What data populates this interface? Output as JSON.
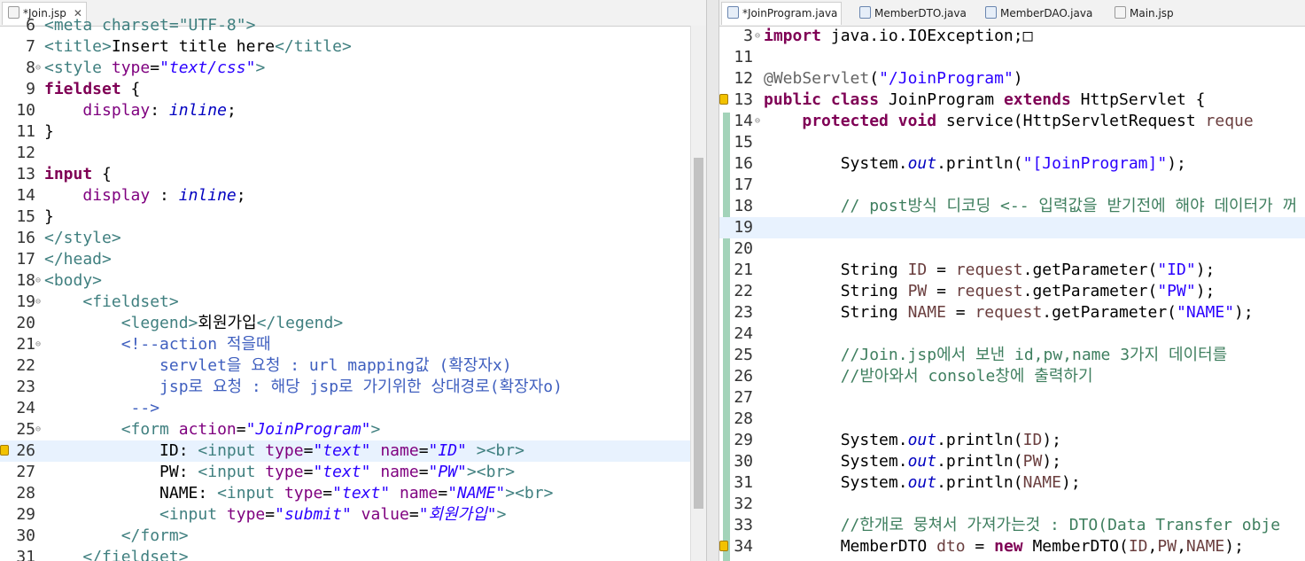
{
  "left_tabs": [
    {
      "label": "*Join.jsp",
      "icon": "jsp-file-icon"
    }
  ],
  "right_tabs": [
    {
      "label": "*JoinProgram.java",
      "icon": "java-file-icon"
    },
    {
      "label": "MemberDTO.java",
      "icon": "java-file-icon"
    },
    {
      "label": "MemberDAO.java",
      "icon": "java-file-icon"
    },
    {
      "label": "Main.jsp",
      "icon": "jsp-file-icon"
    }
  ],
  "left_lines": [
    {
      "n": "6",
      "t": [
        [
          "tag",
          "<meta charset=\"UTF-8\">"
        ]
      ]
    },
    {
      "n": "7",
      "t": [
        [
          "tag",
          "<title>"
        ],
        [
          "",
          "Insert title here"
        ],
        [
          "tag",
          "</title>"
        ]
      ]
    },
    {
      "n": "8",
      "fold": true,
      "t": [
        [
          "tag",
          "<style "
        ],
        [
          "attr",
          "type"
        ],
        [
          "",
          "="
        ],
        [
          "str",
          "\"text/css\""
        ],
        [
          "tag",
          ">"
        ]
      ]
    },
    {
      "n": "9",
      "t": [
        [
          "kw",
          "fieldset"
        ],
        [
          "",
          " {"
        ]
      ]
    },
    {
      "n": "10",
      "t": [
        [
          "",
          "    "
        ],
        [
          "attr",
          "display"
        ],
        [
          "",
          ": "
        ],
        [
          "fld",
          "inline"
        ],
        [
          "",
          ";"
        ]
      ]
    },
    {
      "n": "11",
      "t": [
        [
          "",
          "}"
        ]
      ]
    },
    {
      "n": "12",
      "t": []
    },
    {
      "n": "13",
      "t": [
        [
          "kw",
          "input"
        ],
        [
          "",
          " {"
        ]
      ]
    },
    {
      "n": "14",
      "t": [
        [
          "",
          "    "
        ],
        [
          "attr",
          "display"
        ],
        [
          "",
          " : "
        ],
        [
          "fld",
          "inline"
        ],
        [
          "",
          ";"
        ]
      ]
    },
    {
      "n": "15",
      "t": [
        [
          "",
          "}"
        ]
      ]
    },
    {
      "n": "16",
      "t": [
        [
          "tag",
          "</style>"
        ]
      ]
    },
    {
      "n": "17",
      "t": [
        [
          "tag",
          "</head>"
        ]
      ]
    },
    {
      "n": "18",
      "fold": true,
      "t": [
        [
          "tag",
          "<body>"
        ]
      ]
    },
    {
      "n": "19",
      "fold": true,
      "t": [
        [
          "",
          "    "
        ],
        [
          "tag",
          "<fieldset>"
        ]
      ]
    },
    {
      "n": "20",
      "t": [
        [
          "",
          "        "
        ],
        [
          "tag",
          "<legend>"
        ],
        [
          "",
          "회원가입"
        ],
        [
          "tag",
          "</legend>"
        ]
      ]
    },
    {
      "n": "21",
      "fold": true,
      "t": [
        [
          "",
          "        "
        ],
        [
          "cmt",
          "<!--action 적을때"
        ]
      ]
    },
    {
      "n": "22",
      "t": [
        [
          "",
          "            "
        ],
        [
          "cmt",
          "servlet을 요청 : url mapping값 (확장자x)"
        ]
      ]
    },
    {
      "n": "23",
      "t": [
        [
          "",
          "            "
        ],
        [
          "cmt",
          "jsp로 요청 : 해당 jsp로 가기위한 상대경로(확장자o)"
        ]
      ]
    },
    {
      "n": "24",
      "t": [
        [
          "",
          "         "
        ],
        [
          "cmt",
          "-->"
        ]
      ]
    },
    {
      "n": "25",
      "fold": true,
      "t": [
        [
          "",
          "        "
        ],
        [
          "tag",
          "<form "
        ],
        [
          "attr",
          "action"
        ],
        [
          "",
          "="
        ],
        [
          "str",
          "\"JoinProgram\""
        ],
        [
          "tag",
          ">"
        ]
      ]
    },
    {
      "n": "26",
      "hl": true,
      "mark": true,
      "t": [
        [
          "",
          "            ID: "
        ],
        [
          "tag",
          "<input "
        ],
        [
          "attr",
          "type"
        ],
        [
          "",
          "="
        ],
        [
          "str",
          "\"text\""
        ],
        [
          "",
          " "
        ],
        [
          "attr",
          "name"
        ],
        [
          "",
          "="
        ],
        [
          "str",
          "\"ID\""
        ],
        [
          "",
          " "
        ],
        [
          "tag",
          "><br>"
        ]
      ]
    },
    {
      "n": "27",
      "t": [
        [
          "",
          "            PW: "
        ],
        [
          "tag",
          "<input "
        ],
        [
          "attr",
          "type"
        ],
        [
          "",
          "="
        ],
        [
          "str",
          "\"text\""
        ],
        [
          "",
          " "
        ],
        [
          "attr",
          "name"
        ],
        [
          "",
          "="
        ],
        [
          "str",
          "\"PW\""
        ],
        [
          "tag",
          "><br>"
        ]
      ]
    },
    {
      "n": "28",
      "t": [
        [
          "",
          "            NAME: "
        ],
        [
          "tag",
          "<input "
        ],
        [
          "attr",
          "type"
        ],
        [
          "",
          "="
        ],
        [
          "str",
          "\"text\""
        ],
        [
          "",
          " "
        ],
        [
          "attr",
          "name"
        ],
        [
          "",
          "="
        ],
        [
          "str",
          "\"NAME\""
        ],
        [
          "tag",
          "><br>"
        ]
      ]
    },
    {
      "n": "29",
      "t": [
        [
          "",
          "            "
        ],
        [
          "tag",
          "<input "
        ],
        [
          "attr",
          "type"
        ],
        [
          "",
          "="
        ],
        [
          "str",
          "\"submit\""
        ],
        [
          "",
          " "
        ],
        [
          "attr",
          "value"
        ],
        [
          "",
          "="
        ],
        [
          "str",
          "\"회원가입\""
        ],
        [
          "tag",
          ">"
        ]
      ]
    },
    {
      "n": "30",
      "t": [
        [
          "",
          "        "
        ],
        [
          "tag",
          "</form>"
        ]
      ]
    },
    {
      "n": "31",
      "t": [
        [
          "",
          "    "
        ],
        [
          "tag",
          "</fieldset>"
        ]
      ]
    }
  ],
  "right_lines": [
    {
      "n": "3",
      "fold": true,
      "t": [
        [
          "kw",
          "import"
        ],
        [
          "",
          " java.io.IOException;"
        ],
        [
          "",
          "□"
        ]
      ]
    },
    {
      "n": "11",
      "t": []
    },
    {
      "n": "12",
      "t": [
        [
          "ann",
          "@WebServlet"
        ],
        [
          "",
          "("
        ],
        [
          "jstr",
          "\"/JoinProgram\""
        ],
        [
          "",
          ")"
        ]
      ]
    },
    {
      "n": "13",
      "mark": true,
      "t": [
        [
          "kw",
          "public class"
        ],
        [
          "",
          " JoinProgram "
        ],
        [
          "kw",
          "extends"
        ],
        [
          "",
          " HttpServlet {"
        ]
      ]
    },
    {
      "n": "14",
      "fold": true,
      "t": [
        [
          "",
          "    "
        ],
        [
          "kw",
          "protected void"
        ],
        [
          "",
          " service(HttpServletRequest "
        ],
        [
          "var",
          "reque"
        ]
      ]
    },
    {
      "n": "15",
      "t": []
    },
    {
      "n": "16",
      "t": [
        [
          "",
          "        System."
        ],
        [
          "fld",
          "out"
        ],
        [
          "",
          ".println("
        ],
        [
          "jstr",
          "\"[JoinProgram]\""
        ],
        [
          "",
          ");"
        ]
      ]
    },
    {
      "n": "17",
      "t": []
    },
    {
      "n": "18",
      "t": [
        [
          "",
          "        "
        ],
        [
          "jcmt",
          "// post방식 디코딩 <-- 입력값을 받기전에 해야 데이터가 꺼"
        ]
      ]
    },
    {
      "n": "19",
      "hl": true,
      "t": []
    },
    {
      "n": "20",
      "t": []
    },
    {
      "n": "21",
      "t": [
        [
          "",
          "        String "
        ],
        [
          "var",
          "ID"
        ],
        [
          "",
          " = "
        ],
        [
          "var",
          "request"
        ],
        [
          "",
          ".getParameter("
        ],
        [
          "jstr",
          "\"ID\""
        ],
        [
          "",
          ");"
        ]
      ]
    },
    {
      "n": "22",
      "t": [
        [
          "",
          "        String "
        ],
        [
          "var",
          "PW"
        ],
        [
          "",
          " = "
        ],
        [
          "var",
          "request"
        ],
        [
          "",
          ".getParameter("
        ],
        [
          "jstr",
          "\"PW\""
        ],
        [
          "",
          ");"
        ]
      ]
    },
    {
      "n": "23",
      "t": [
        [
          "",
          "        String "
        ],
        [
          "var",
          "NAME"
        ],
        [
          "",
          " = "
        ],
        [
          "var",
          "request"
        ],
        [
          "",
          ".getParameter("
        ],
        [
          "jstr",
          "\"NAME\""
        ],
        [
          "",
          ");"
        ]
      ]
    },
    {
      "n": "24",
      "t": []
    },
    {
      "n": "25",
      "t": [
        [
          "",
          "        "
        ],
        [
          "jcmt",
          "//Join.jsp에서 보낸 id,pw,name 3가지 데이터를"
        ]
      ]
    },
    {
      "n": "26",
      "t": [
        [
          "",
          "        "
        ],
        [
          "jcmt",
          "//받아와서 console창에 출력하기"
        ]
      ]
    },
    {
      "n": "27",
      "t": []
    },
    {
      "n": "28",
      "t": []
    },
    {
      "n": "29",
      "t": [
        [
          "",
          "        System."
        ],
        [
          "fld",
          "out"
        ],
        [
          "",
          ".println("
        ],
        [
          "var",
          "ID"
        ],
        [
          "",
          ");"
        ]
      ]
    },
    {
      "n": "30",
      "t": [
        [
          "",
          "        System."
        ],
        [
          "fld",
          "out"
        ],
        [
          "",
          ".println("
        ],
        [
          "var",
          "PW"
        ],
        [
          "",
          ");"
        ]
      ]
    },
    {
      "n": "31",
      "t": [
        [
          "",
          "        System."
        ],
        [
          "fld",
          "out"
        ],
        [
          "",
          ".println("
        ],
        [
          "var",
          "NAME"
        ],
        [
          "",
          ");"
        ]
      ]
    },
    {
      "n": "32",
      "t": []
    },
    {
      "n": "33",
      "t": [
        [
          "",
          "        "
        ],
        [
          "jcmt",
          "//한개로 뭉쳐서 가져가는것 : DTO(Data Transfer obje"
        ]
      ]
    },
    {
      "n": "34",
      "mark": true,
      "t": [
        [
          "",
          "        MemberDTO "
        ],
        [
          "var",
          "dto"
        ],
        [
          "",
          " = "
        ],
        [
          "kw",
          "new"
        ],
        [
          "",
          " MemberDTO("
        ],
        [
          "var",
          "ID"
        ],
        [
          "",
          ","
        ],
        [
          "var",
          "PW"
        ],
        [
          "",
          ","
        ],
        [
          "var",
          "NAME"
        ],
        [
          "",
          ");"
        ]
      ]
    }
  ]
}
